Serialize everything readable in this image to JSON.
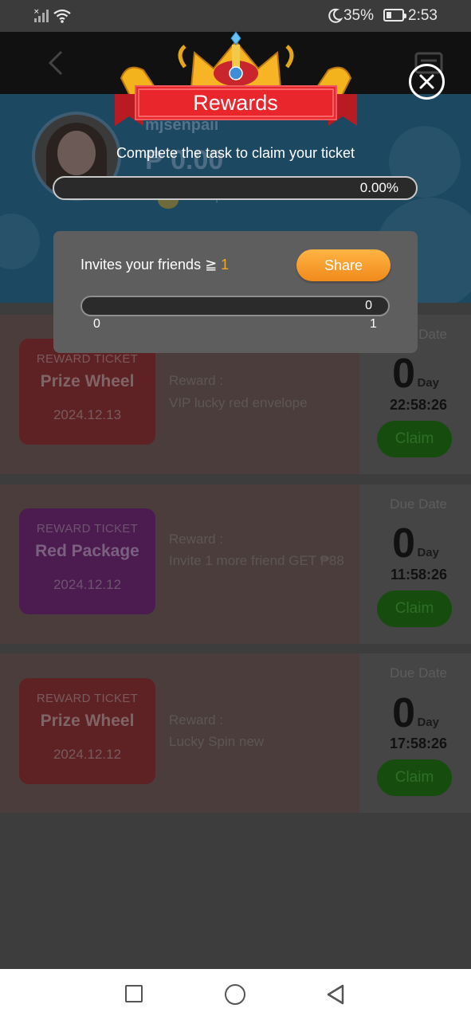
{
  "status_bar": {
    "battery_percent": "35%",
    "battery_level": 0.35,
    "time": "2:53",
    "icons": [
      "signal-icon",
      "wifi-icon",
      "moon-icon",
      "battery-icon"
    ]
  },
  "header": {
    "back_icon": "chevron-left-icon",
    "right_icon": "ticket-icon"
  },
  "profile": {
    "username": "mjsenpaii",
    "balance": "₱ 0.00",
    "points": "Total points 2"
  },
  "tickets": [
    {
      "tag": "REWARD TICKET",
      "name": "Prize Wheel",
      "date": "2024.12.13",
      "color": "red",
      "reward_label": "Reward :",
      "reward_text": "VIP lucky red envelope",
      "due_label": "Due Date",
      "days": "0",
      "day_unit": "Day",
      "countdown": "22:58:26",
      "claim_label": "Claim"
    },
    {
      "tag": "REWARD TICKET",
      "name": "Red Package",
      "date": "2024.12.12",
      "color": "purple",
      "reward_label": "Reward :",
      "reward_text": "Invite 1 more friend GET ₱88",
      "due_label": "Due Date",
      "days": "0",
      "day_unit": "Day",
      "countdown": "11:58:26",
      "claim_label": "Claim"
    },
    {
      "tag": "REWARD TICKET",
      "name": "Prize Wheel",
      "date": "2024.12.12",
      "color": "red",
      "reward_label": "Reward :",
      "reward_text": "Lucky Spin new",
      "due_label": "Due Date",
      "days": "0",
      "day_unit": "Day",
      "countdown": "17:58:26",
      "claim_label": "Claim"
    }
  ],
  "modal": {
    "title": "Rewards",
    "subtitle": "Complete the task to claim your ticket",
    "progress_text": "0.00%",
    "progress_value": 0,
    "task": {
      "label": "Invites your friends ≧ ",
      "target": "1",
      "share_label": "Share",
      "current": "0",
      "min": "0",
      "max": "1"
    },
    "close_icon": "close-icon"
  },
  "nav": {
    "icons": [
      "recents-square-icon",
      "home-circle-icon",
      "back-triangle-icon"
    ]
  },
  "colors": {
    "accent_orange": "#f5a623",
    "claim_green": "#164d0f",
    "ribbon_red": "#e8262b",
    "crown_gold": "#f2b31d"
  }
}
